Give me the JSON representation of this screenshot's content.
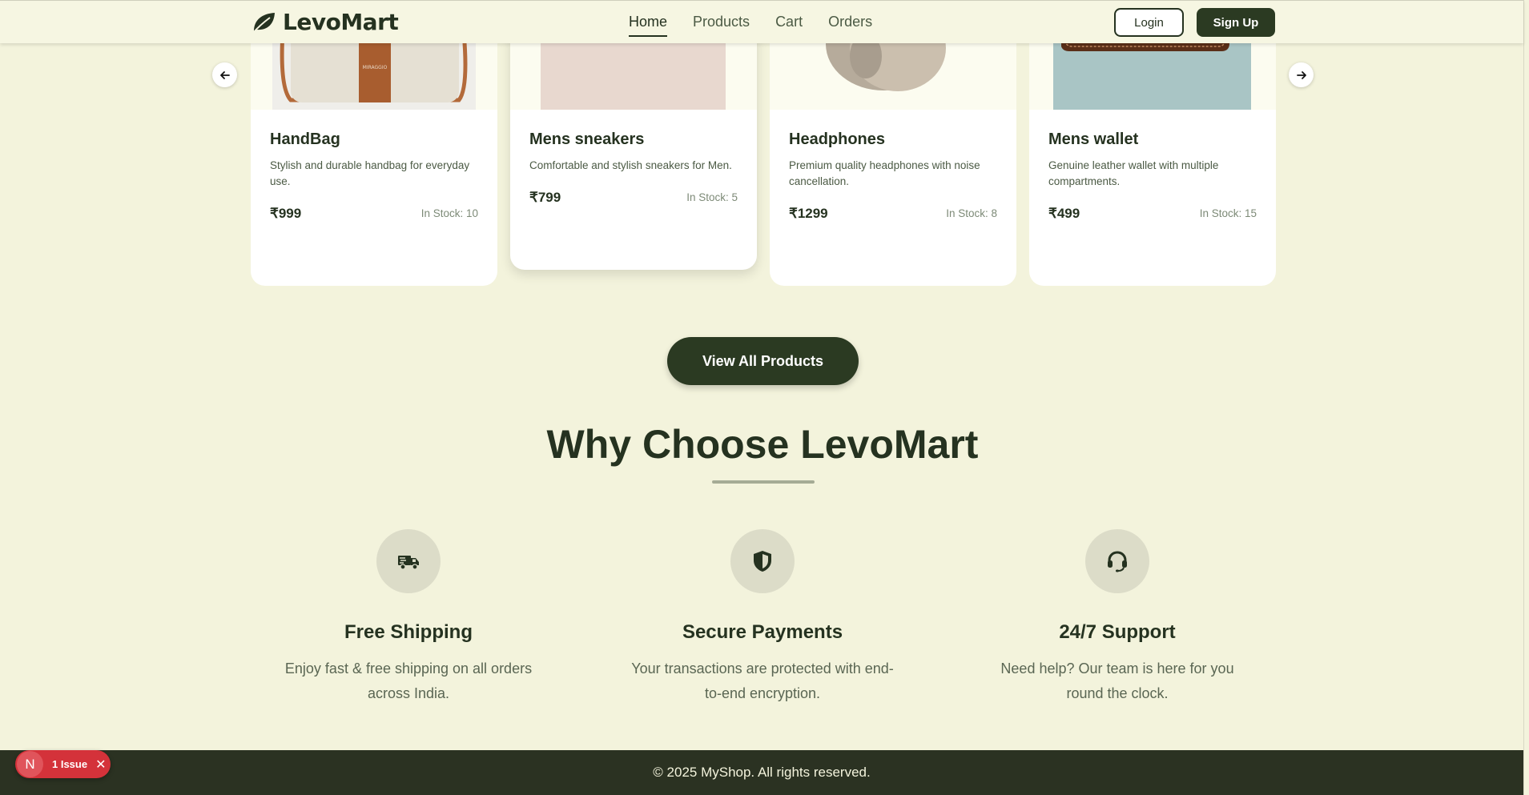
{
  "header": {
    "brand": "LevoMart",
    "nav": [
      {
        "label": "Home",
        "active": true
      },
      {
        "label": "Products",
        "active": false
      },
      {
        "label": "Cart",
        "active": false
      },
      {
        "label": "Orders",
        "active": false
      }
    ],
    "login_label": "Login",
    "signup_label": "Sign Up"
  },
  "products": [
    {
      "title": "HandBag",
      "desc_lines": [
        "Stylish and durable handbag for everyday",
        "use."
      ],
      "price": "₹999",
      "stock": "In Stock: 10",
      "icon": "handbag-image"
    },
    {
      "title": "Mens sneakers",
      "desc_lines": [
        "Comfortable and stylish sneakers for Men."
      ],
      "price": "₹799",
      "stock": "In Stock: 5",
      "icon": "sneakers-image"
    },
    {
      "title": "Headphones",
      "desc_lines": [
        "Premium quality headphones with noise",
        "cancellation."
      ],
      "price": "₹1299",
      "stock": "In Stock: 8",
      "icon": "headphones-image"
    },
    {
      "title": "Mens wallet",
      "desc_lines": [
        "Genuine leather wallet with multiple",
        "compartments."
      ],
      "price": "₹499",
      "stock": "In Stock: 15",
      "icon": "wallet-image"
    }
  ],
  "view_all_label": "View All Products",
  "why": {
    "title": "Why Choose LevoMart",
    "features": [
      {
        "title": "Free Shipping",
        "lines": [
          "Enjoy fast & free shipping on all orders",
          "across India."
        ],
        "icon": "truck-icon"
      },
      {
        "title": "Secure Payments",
        "lines": [
          "Your transactions are protected with end-",
          "to-end encryption."
        ],
        "icon": "shield-icon"
      },
      {
        "title": "24/7 Support",
        "lines": [
          "Need help? Our team is here for you",
          "round the clock."
        ],
        "icon": "headset-icon"
      }
    ]
  },
  "footer": {
    "text": "© 2025 MyShop. All rights reserved."
  },
  "issue_badge": {
    "letter": "N",
    "label": "1 Issue"
  },
  "colors": {
    "background": "#f3f3dc",
    "primary": "#2b3a22",
    "issue": "#d4323a"
  }
}
